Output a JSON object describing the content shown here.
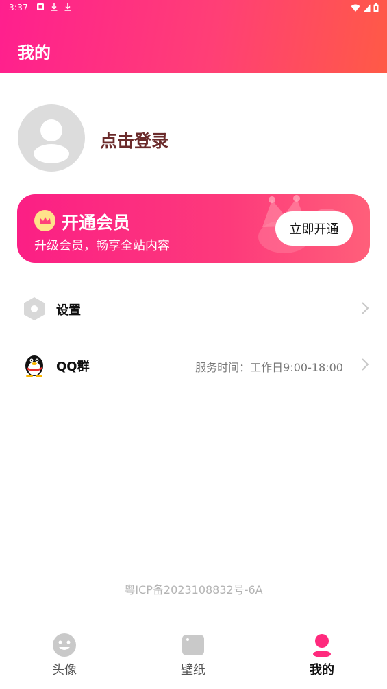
{
  "status_bar": {
    "time": "3:37",
    "left_icons": [
      "notification-icon",
      "download-icon",
      "download-icon"
    ],
    "right_icons": [
      "wifi-icon",
      "signal-icon",
      "battery-icon"
    ]
  },
  "header": {
    "title": "我的"
  },
  "profile": {
    "login_text": "点击登录"
  },
  "vip": {
    "title": "开通会员",
    "subtitle": "升级会员，畅享全站内容",
    "button_label": "立即开通"
  },
  "menu": {
    "settings": {
      "label": "设置",
      "icon": "settings-hex-icon"
    },
    "qq_group": {
      "label": "QQ群",
      "icon": "qq-penguin-icon",
      "service_time": "服务时间：工作日9:00-18:00"
    }
  },
  "footer": {
    "icp": "粤ICP备2023108832号-6A"
  },
  "tabs": [
    {
      "label": "头像",
      "icon": "avatar-face-icon",
      "active": false
    },
    {
      "label": "壁纸",
      "icon": "wallpaper-icon",
      "active": false
    },
    {
      "label": "我的",
      "icon": "profile-icon",
      "active": true
    }
  ],
  "colors": {
    "brand_pink": "#ff1f8e",
    "brand_orange": "#ff5a46",
    "login_text": "#6b2b2b",
    "muted_text": "#777777"
  }
}
